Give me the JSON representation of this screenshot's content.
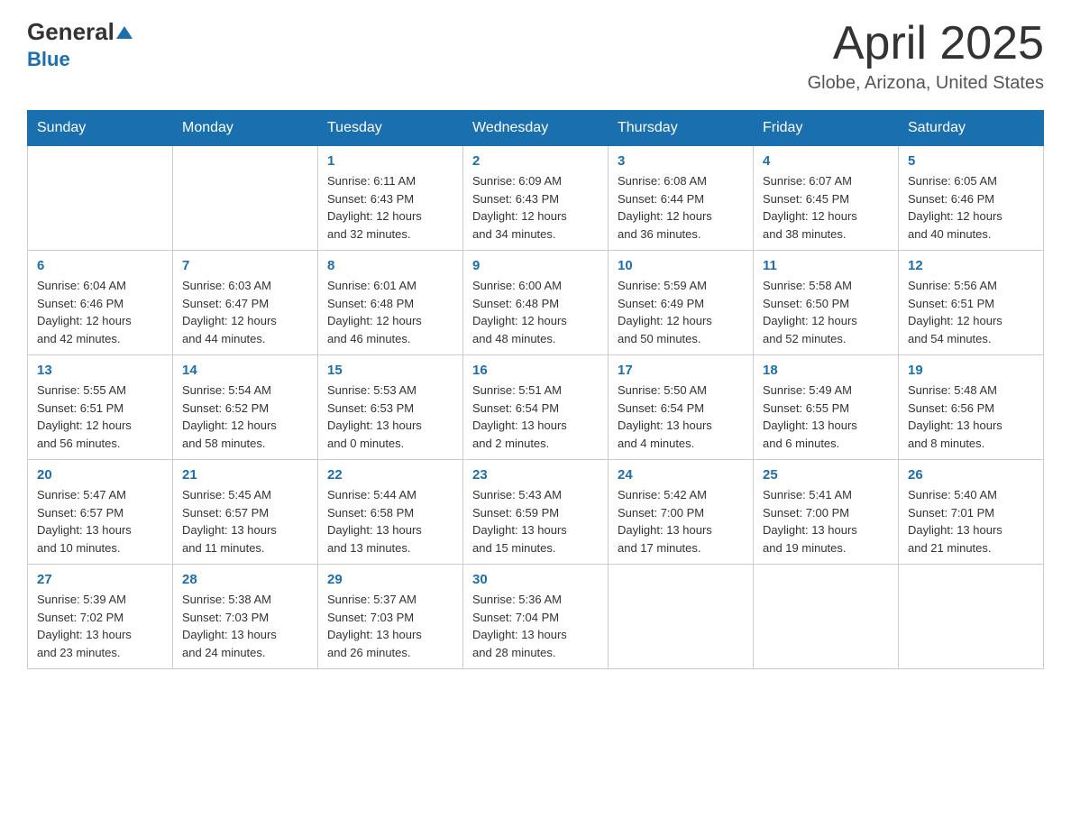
{
  "logo": {
    "general": "General",
    "blue": "Blue",
    "triangle": "▼"
  },
  "title": {
    "month": "April 2025",
    "location": "Globe, Arizona, United States"
  },
  "header_days": [
    "Sunday",
    "Monday",
    "Tuesday",
    "Wednesday",
    "Thursday",
    "Friday",
    "Saturday"
  ],
  "weeks": [
    [
      {
        "day": "",
        "info": ""
      },
      {
        "day": "",
        "info": ""
      },
      {
        "day": "1",
        "info": "Sunrise: 6:11 AM\nSunset: 6:43 PM\nDaylight: 12 hours\nand 32 minutes."
      },
      {
        "day": "2",
        "info": "Sunrise: 6:09 AM\nSunset: 6:43 PM\nDaylight: 12 hours\nand 34 minutes."
      },
      {
        "day": "3",
        "info": "Sunrise: 6:08 AM\nSunset: 6:44 PM\nDaylight: 12 hours\nand 36 minutes."
      },
      {
        "day": "4",
        "info": "Sunrise: 6:07 AM\nSunset: 6:45 PM\nDaylight: 12 hours\nand 38 minutes."
      },
      {
        "day": "5",
        "info": "Sunrise: 6:05 AM\nSunset: 6:46 PM\nDaylight: 12 hours\nand 40 minutes."
      }
    ],
    [
      {
        "day": "6",
        "info": "Sunrise: 6:04 AM\nSunset: 6:46 PM\nDaylight: 12 hours\nand 42 minutes."
      },
      {
        "day": "7",
        "info": "Sunrise: 6:03 AM\nSunset: 6:47 PM\nDaylight: 12 hours\nand 44 minutes."
      },
      {
        "day": "8",
        "info": "Sunrise: 6:01 AM\nSunset: 6:48 PM\nDaylight: 12 hours\nand 46 minutes."
      },
      {
        "day": "9",
        "info": "Sunrise: 6:00 AM\nSunset: 6:48 PM\nDaylight: 12 hours\nand 48 minutes."
      },
      {
        "day": "10",
        "info": "Sunrise: 5:59 AM\nSunset: 6:49 PM\nDaylight: 12 hours\nand 50 minutes."
      },
      {
        "day": "11",
        "info": "Sunrise: 5:58 AM\nSunset: 6:50 PM\nDaylight: 12 hours\nand 52 minutes."
      },
      {
        "day": "12",
        "info": "Sunrise: 5:56 AM\nSunset: 6:51 PM\nDaylight: 12 hours\nand 54 minutes."
      }
    ],
    [
      {
        "day": "13",
        "info": "Sunrise: 5:55 AM\nSunset: 6:51 PM\nDaylight: 12 hours\nand 56 minutes."
      },
      {
        "day": "14",
        "info": "Sunrise: 5:54 AM\nSunset: 6:52 PM\nDaylight: 12 hours\nand 58 minutes."
      },
      {
        "day": "15",
        "info": "Sunrise: 5:53 AM\nSunset: 6:53 PM\nDaylight: 13 hours\nand 0 minutes."
      },
      {
        "day": "16",
        "info": "Sunrise: 5:51 AM\nSunset: 6:54 PM\nDaylight: 13 hours\nand 2 minutes."
      },
      {
        "day": "17",
        "info": "Sunrise: 5:50 AM\nSunset: 6:54 PM\nDaylight: 13 hours\nand 4 minutes."
      },
      {
        "day": "18",
        "info": "Sunrise: 5:49 AM\nSunset: 6:55 PM\nDaylight: 13 hours\nand 6 minutes."
      },
      {
        "day": "19",
        "info": "Sunrise: 5:48 AM\nSunset: 6:56 PM\nDaylight: 13 hours\nand 8 minutes."
      }
    ],
    [
      {
        "day": "20",
        "info": "Sunrise: 5:47 AM\nSunset: 6:57 PM\nDaylight: 13 hours\nand 10 minutes."
      },
      {
        "day": "21",
        "info": "Sunrise: 5:45 AM\nSunset: 6:57 PM\nDaylight: 13 hours\nand 11 minutes."
      },
      {
        "day": "22",
        "info": "Sunrise: 5:44 AM\nSunset: 6:58 PM\nDaylight: 13 hours\nand 13 minutes."
      },
      {
        "day": "23",
        "info": "Sunrise: 5:43 AM\nSunset: 6:59 PM\nDaylight: 13 hours\nand 15 minutes."
      },
      {
        "day": "24",
        "info": "Sunrise: 5:42 AM\nSunset: 7:00 PM\nDaylight: 13 hours\nand 17 minutes."
      },
      {
        "day": "25",
        "info": "Sunrise: 5:41 AM\nSunset: 7:00 PM\nDaylight: 13 hours\nand 19 minutes."
      },
      {
        "day": "26",
        "info": "Sunrise: 5:40 AM\nSunset: 7:01 PM\nDaylight: 13 hours\nand 21 minutes."
      }
    ],
    [
      {
        "day": "27",
        "info": "Sunrise: 5:39 AM\nSunset: 7:02 PM\nDaylight: 13 hours\nand 23 minutes."
      },
      {
        "day": "28",
        "info": "Sunrise: 5:38 AM\nSunset: 7:03 PM\nDaylight: 13 hours\nand 24 minutes."
      },
      {
        "day": "29",
        "info": "Sunrise: 5:37 AM\nSunset: 7:03 PM\nDaylight: 13 hours\nand 26 minutes."
      },
      {
        "day": "30",
        "info": "Sunrise: 5:36 AM\nSunset: 7:04 PM\nDaylight: 13 hours\nand 28 minutes."
      },
      {
        "day": "",
        "info": ""
      },
      {
        "day": "",
        "info": ""
      },
      {
        "day": "",
        "info": ""
      }
    ]
  ]
}
